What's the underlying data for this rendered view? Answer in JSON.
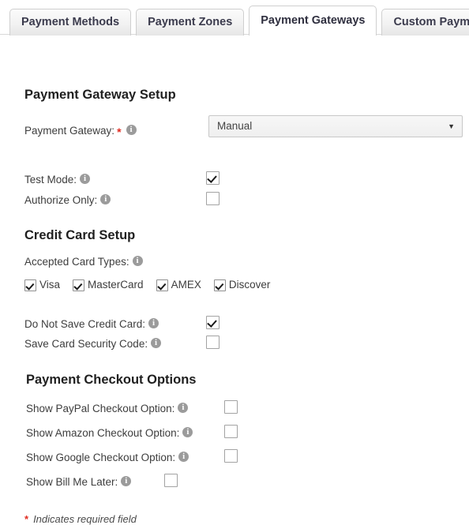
{
  "tabs": [
    {
      "label": "Payment Methods",
      "active": false
    },
    {
      "label": "Payment Zones",
      "active": false
    },
    {
      "label": "Payment Gateways",
      "active": true
    },
    {
      "label": "Custom Payment Fields",
      "active": false
    }
  ],
  "sections": {
    "gateway_setup": {
      "title": "Payment Gateway Setup",
      "gateway_label": "Payment Gateway:",
      "gateway_required": "*",
      "gateway_value": "Manual",
      "gateway_options": [
        "Manual"
      ],
      "test_mode_label": "Test Mode:",
      "test_mode_checked": true,
      "authorize_only_label": "Authorize Only:",
      "authorize_only_checked": false
    },
    "credit_card_setup": {
      "title": "Credit Card Setup",
      "accepted_card_types_label": "Accepted Card Types:",
      "card_types": [
        {
          "label": "Visa",
          "checked": true
        },
        {
          "label": "MasterCard",
          "checked": true
        },
        {
          "label": "AMEX",
          "checked": true
        },
        {
          "label": "Discover",
          "checked": true
        }
      ],
      "do_not_save_label": "Do Not Save Credit Card:",
      "do_not_save_checked": true,
      "save_security_code_label": "Save Card Security Code:",
      "save_security_code_checked": false
    },
    "checkout_options": {
      "title": "Payment Checkout Options",
      "paypal_label": "Show PayPal Checkout Option:",
      "paypal_checked": false,
      "amazon_label": "Show Amazon Checkout Option:",
      "amazon_checked": false,
      "google_label": "Show Google Checkout Option:",
      "google_checked": false,
      "bill_me_later_label": "Show Bill Me Later:",
      "bill_me_later_checked": false
    }
  },
  "footer": {
    "required_star": "*",
    "required_note": "Indicates required field"
  },
  "icons": {
    "info": "info-icon",
    "dropdown_arrow": "▼"
  },
  "colors": {
    "required_star": "#e02b20",
    "info_icon": "#9b9b9b",
    "tab_active_bg": "#ffffff",
    "tab_inactive_bg": "#f0f0f0"
  }
}
